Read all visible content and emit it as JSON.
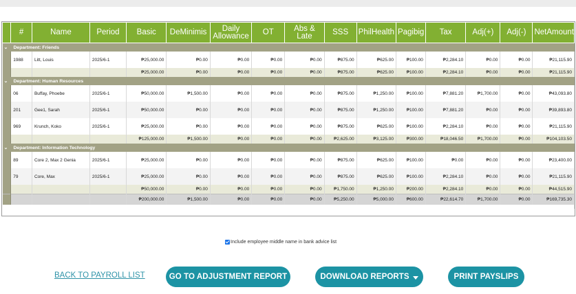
{
  "columns": [
    "#",
    "Name",
    "Period",
    "Basic",
    "DeMinimis",
    "Daily Allowance",
    "OT",
    "Abs & Late",
    "SSS",
    "PhilHealth",
    "Pagibig",
    "Tax",
    "Adj(+)",
    "Adj(-)",
    "NetAmount"
  ],
  "groups": [
    {
      "label": "Department: Friends",
      "rows": [
        [
          "1988",
          "Litt, Louis",
          "2025/6-1",
          "₱25,000.00",
          "₱0.00",
          "₱0.00",
          "₱0.00",
          "₱0.00",
          "₱875.00",
          "₱625.00",
          "₱100.00",
          "₱2,284.10",
          "₱0.00",
          "₱0.00",
          "₱21,115.90"
        ]
      ],
      "subtotal": [
        "₱25,000.00",
        "₱0.00",
        "₱0.00",
        "₱0.00",
        "₱0.00",
        "₱875.00",
        "₱625.00",
        "₱100.00",
        "₱2,284.10",
        "₱0.00",
        "₱0.00",
        "₱21,115.90"
      ]
    },
    {
      "label": "Department: Human Resources",
      "rows": [
        [
          "06",
          "Buffay, Phoebe",
          "2025/6-1",
          "₱50,000.00",
          "₱1,500.00",
          "₱0.00",
          "₱0.00",
          "₱0.00",
          "₱875.00",
          "₱1,250.00",
          "₱100.00",
          "₱7,881.20",
          "₱1,700.00",
          "₱0.00",
          "₱43,093.80"
        ],
        [
          "201",
          "Gee1, Sarah",
          "2025/6-1",
          "₱50,000.00",
          "₱0.00",
          "₱0.00",
          "₱0.00",
          "₱0.00",
          "₱875.00",
          "₱1,250.00",
          "₱100.00",
          "₱7,881.20",
          "₱0.00",
          "₱0.00",
          "₱39,893.80"
        ],
        [
          "969",
          "Krunch, Koko",
          "2025/6-1",
          "₱25,000.00",
          "₱0.00",
          "₱0.00",
          "₱0.00",
          "₱0.00",
          "₱875.00",
          "₱625.00",
          "₱100.00",
          "₱2,284.10",
          "₱0.00",
          "₱0.00",
          "₱21,115.90"
        ]
      ],
      "subtotal": [
        "₱125,000.00",
        "₱1,500.00",
        "₱0.00",
        "₱0.00",
        "₱0.00",
        "₱2,625.00",
        "₱3,125.00",
        "₱300.00",
        "₱18,046.50",
        "₱1,700.00",
        "₱0.00",
        "₱104,103.50"
      ]
    },
    {
      "label": "Department: Information Technology",
      "rows": [
        [
          "89",
          "Core 2, Max 2 Genia",
          "2025/6-1",
          "₱25,000.00",
          "₱0.00",
          "₱0.00",
          "₱0.00",
          "₱0.00",
          "₱875.00",
          "₱625.00",
          "₱100.00",
          "₱0.00",
          "₱0.00",
          "₱0.00",
          "₱23,400.00"
        ],
        [
          "79",
          "Core, Max",
          "2025/6-1",
          "₱25,000.00",
          "₱0.00",
          "₱0.00",
          "₱0.00",
          "₱0.00",
          "₱875.00",
          "₱625.00",
          "₱100.00",
          "₱2,284.10",
          "₱0.00",
          "₱0.00",
          "₱21,115.90"
        ]
      ],
      "subtotal": [
        "₱50,000.00",
        "₱0.00",
        "₱0.00",
        "₱0.00",
        "₱0.00",
        "₱1,750.00",
        "₱1,250.00",
        "₱200.00",
        "₱2,284.10",
        "₱0.00",
        "₱0.00",
        "₱44,515.90"
      ]
    }
  ],
  "grand_total": [
    "₱200,000.00",
    "₱1,500.00",
    "₱0.00",
    "₱0.00",
    "₱0.00",
    "₱5,250.00",
    "₱5,000.00",
    "₱600.00",
    "₱22,614.70",
    "₱1,700.00",
    "₱0.00",
    "₱169,735.30"
  ],
  "checkbox": {
    "label": "Include employee middle name in bank advice list",
    "checked": true
  },
  "actions": {
    "back_link": "BACK TO PAYROLL LIST",
    "adjustment_report": "GO TO ADJUSTMENT REPORT",
    "download_reports": "DOWNLOAD REPORTS",
    "print_payslips": "PRINT PAYSLIPS"
  },
  "colors": {
    "header_green": "#82b032",
    "group_band": "#a2a285",
    "button_teal": "#1c93a4",
    "link_teal": "#2f93a8"
  },
  "icons": {
    "group_toggle": "chevron-down-icon",
    "download_dropdown": "caret-down-icon"
  }
}
